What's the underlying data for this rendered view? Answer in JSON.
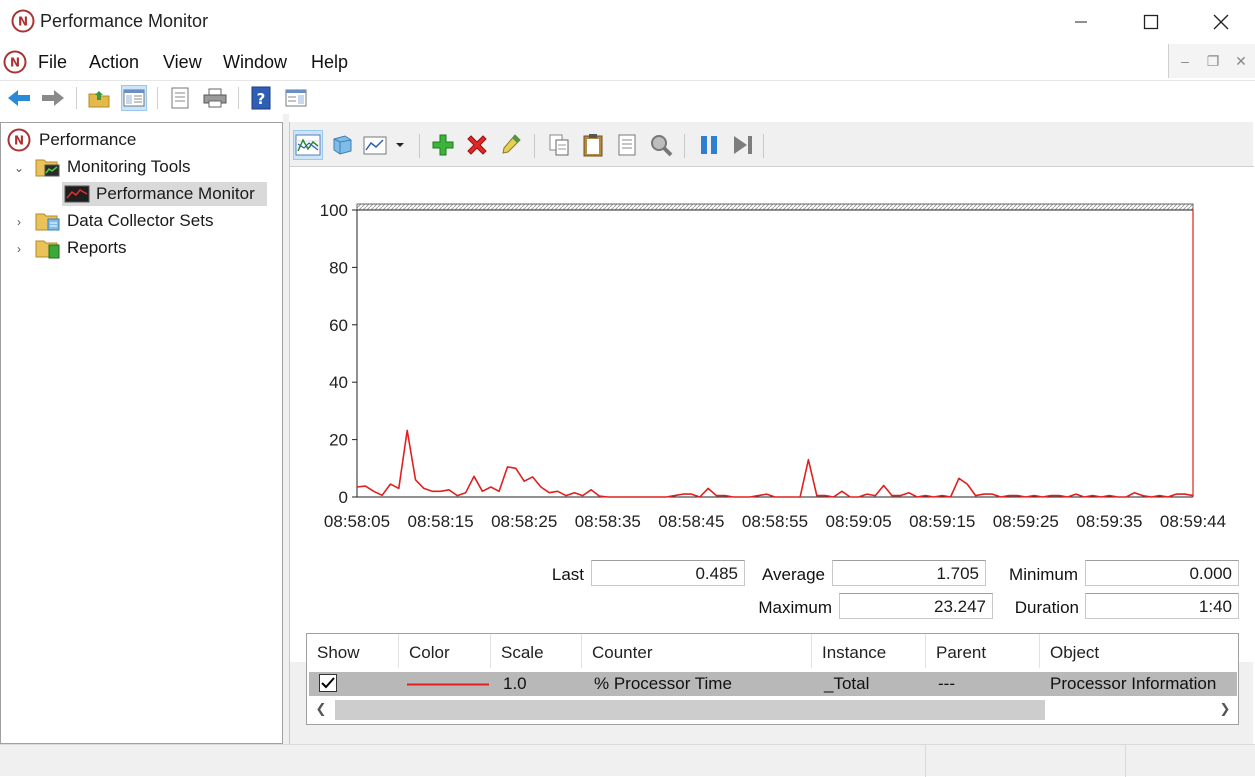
{
  "window": {
    "title": "Performance Monitor"
  },
  "menu": [
    "File",
    "Action",
    "View",
    "Window",
    "Help"
  ],
  "tree": {
    "root": "Performance",
    "monitoring_tools": "Monitoring Tools",
    "performance_monitor": "Performance Monitor",
    "data_collector_sets": "Data Collector Sets",
    "reports": "Reports"
  },
  "stats": {
    "last_label": "Last",
    "last": "0.485",
    "average_label": "Average",
    "average": "1.705",
    "minimum_label": "Minimum",
    "minimum": "0.000",
    "maximum_label": "Maximum",
    "maximum": "23.247",
    "duration_label": "Duration",
    "duration": "1:40"
  },
  "counters": {
    "columns": [
      "Show",
      "Color",
      "Scale",
      "Counter",
      "Instance",
      "Parent",
      "Object"
    ],
    "rows": [
      {
        "show": true,
        "color": "#e02020",
        "scale": "1.0",
        "counter": "% Processor Time",
        "instance": "_Total",
        "parent": "---",
        "object": "Processor Information"
      }
    ]
  },
  "chart_data": {
    "type": "line",
    "ylim": [
      0,
      100
    ],
    "yticks": [
      "100",
      "80",
      "60",
      "40",
      "20",
      "0"
    ],
    "xticks": [
      "08:58:05",
      "08:58:15",
      "08:58:25",
      "08:58:35",
      "08:58:45",
      "08:58:55",
      "08:59:05",
      "08:59:15",
      "08:59:25",
      "08:59:35",
      "08:59:44"
    ],
    "grid": false,
    "series": [
      {
        "color": "#e02020",
        "values": [
          3.5,
          3.8,
          2,
          0.6,
          4.5,
          3,
          23.2,
          6,
          3,
          2,
          2,
          2.5,
          0.5,
          1.5,
          7.2,
          2,
          3.5,
          2,
          10.5,
          10,
          5.5,
          7,
          3.5,
          1.5,
          2,
          0.5,
          1.5,
          0.5,
          2.5,
          0.3,
          0,
          0,
          0,
          0,
          0,
          0,
          0,
          0,
          0.5,
          1,
          1,
          0,
          3,
          0.5,
          0.5,
          0,
          0,
          0,
          0.5,
          1,
          0,
          0,
          0,
          0,
          13,
          0.5,
          0.5,
          0,
          2,
          0,
          0,
          1,
          0.5,
          4,
          0.5,
          0.5,
          1.5,
          0,
          0.5,
          0,
          0.5,
          0,
          6.5,
          4.5,
          0.5,
          1,
          1,
          0,
          0.5,
          0.5,
          0,
          0.5,
          0,
          0.5,
          0.5,
          0,
          1,
          0,
          0.5,
          0,
          0.5,
          0,
          0,
          1.5,
          0.5,
          0,
          0.5,
          0,
          1,
          1,
          0.485
        ]
      }
    ]
  }
}
